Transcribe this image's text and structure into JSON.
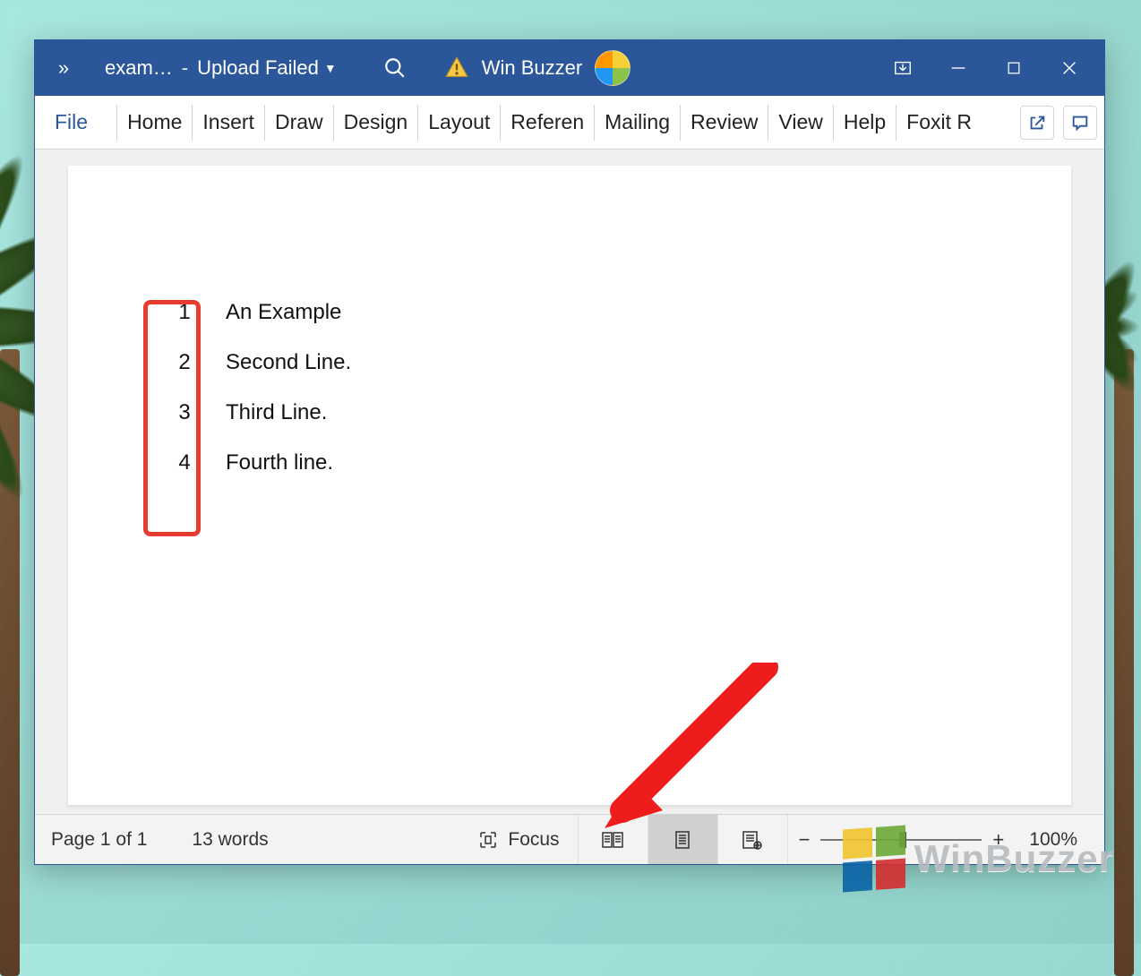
{
  "titlebar": {
    "doc_name": "exam…",
    "separator": "-",
    "status": "Upload Failed",
    "user_name": "Win Buzzer"
  },
  "ribbon": {
    "file_label": "File",
    "tabs": [
      "Home",
      "Insert",
      "Draw",
      "Design",
      "Layout",
      "Referen",
      "Mailing",
      "Review",
      "View",
      "Help",
      "Foxit R"
    ]
  },
  "document": {
    "lines": [
      {
        "n": "1",
        "text": "An Example"
      },
      {
        "n": "2",
        "text": "Second Line."
      },
      {
        "n": "3",
        "text": "Third Line."
      },
      {
        "n": "4",
        "text": "Fourth line."
      }
    ]
  },
  "statusbar": {
    "page_info": "Page 1 of 1",
    "word_count": "13 words",
    "focus_label": "Focus",
    "zoom_value": "100%"
  },
  "watermark": {
    "text": "WinBuzzer"
  }
}
